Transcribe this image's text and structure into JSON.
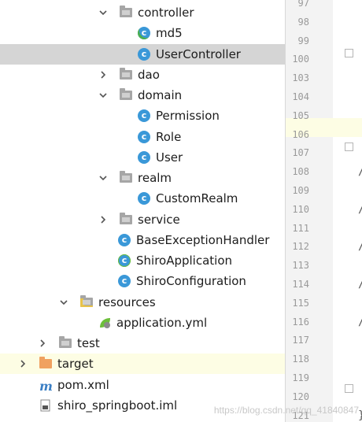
{
  "tree": [
    {
      "label": "controller",
      "icon": "folder-icon",
      "expand": "down",
      "sel": false,
      "hl": false
    },
    {
      "label": "md5",
      "icon": "class-run-icon",
      "expand": "none",
      "sel": false,
      "hl": false
    },
    {
      "label": "UserController",
      "icon": "class-icon",
      "expand": "none",
      "sel": true,
      "hl": false
    },
    {
      "label": "dao",
      "icon": "folder-icon",
      "expand": "right",
      "sel": false,
      "hl": false
    },
    {
      "label": "domain",
      "icon": "folder-icon",
      "expand": "down",
      "sel": false,
      "hl": false
    },
    {
      "label": "Permission",
      "icon": "class-icon",
      "expand": "none",
      "sel": false,
      "hl": false
    },
    {
      "label": "Role",
      "icon": "class-icon",
      "expand": "none",
      "sel": false,
      "hl": false
    },
    {
      "label": "User",
      "icon": "class-icon",
      "expand": "none",
      "sel": false,
      "hl": false
    },
    {
      "label": "realm",
      "icon": "folder-icon",
      "expand": "down",
      "sel": false,
      "hl": false
    },
    {
      "label": "CustomRealm",
      "icon": "class-icon",
      "expand": "none",
      "sel": false,
      "hl": false
    },
    {
      "label": "service",
      "icon": "folder-icon",
      "expand": "right",
      "sel": false,
      "hl": false
    },
    {
      "label": "BaseExceptionHandler",
      "icon": "class-icon",
      "expand": "none",
      "sel": false,
      "hl": false
    },
    {
      "label": "ShiroApplication",
      "icon": "spring-boot-class-icon",
      "expand": "none",
      "sel": false,
      "hl": false
    },
    {
      "label": "ShiroConfiguration",
      "icon": "class-icon",
      "expand": "none",
      "sel": false,
      "hl": false
    },
    {
      "label": "resources",
      "icon": "resources-folder-icon",
      "expand": "down",
      "sel": false,
      "hl": false
    },
    {
      "label": "application.yml",
      "icon": "spring-yml-icon",
      "expand": "none",
      "sel": false,
      "hl": false
    },
    {
      "label": "test",
      "icon": "folder-icon",
      "expand": "right",
      "sel": false,
      "hl": false
    },
    {
      "label": "target",
      "icon": "excluded-folder-icon",
      "expand": "right",
      "sel": false,
      "hl": true
    },
    {
      "label": "pom.xml",
      "icon": "maven-icon",
      "expand": "none",
      "sel": false,
      "hl": false
    },
    {
      "label": "shiro_springboot.iml",
      "icon": "iml-file-icon",
      "expand": "none",
      "sel": false,
      "hl": false
    }
  ],
  "gutter": {
    "line_numbers": [
      "97",
      "98",
      "99",
      "100",
      "103",
      "104",
      "105",
      "106",
      "107",
      "108",
      "109",
      "110",
      "111",
      "112",
      "113",
      "114",
      "115",
      "116",
      "117",
      "118",
      "119",
      "120",
      "121"
    ],
    "code_marks": {
      "108": "/",
      "110": "/",
      "112": "/",
      "114": "/",
      "116": "/",
      "121": "}"
    }
  },
  "watermark": "https://blog.csdn.net/qq_41840847"
}
